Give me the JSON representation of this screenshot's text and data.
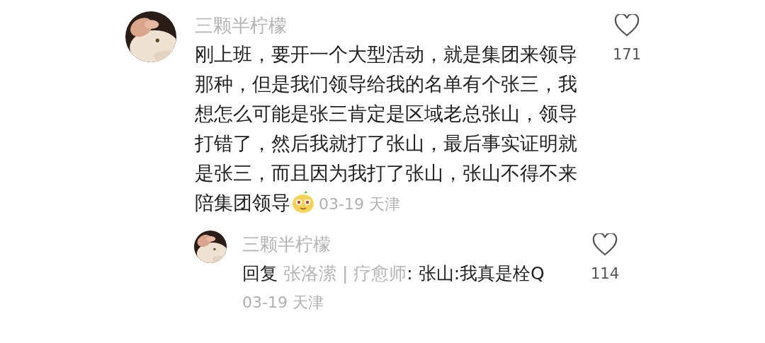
{
  "comment": {
    "author": "三颗半柠檬",
    "text": "刚上班，要开一个大型活动，就是集团来领导那种，但是我们领导给我的名单有个张三，我想怎么可能是张三肯定是区域老总张山，领导打错了，然后我就打了张山，最后事实证明就是张三，而且因为我打了张山，张山不得不来陪集团领导",
    "date": "03-19 天津",
    "likes": "171",
    "liked": false
  },
  "reply": {
    "author": "三颗半柠檬",
    "label": "回复",
    "reply_to": "张洛潆 | 疗愈师",
    "text": ": 张山:我真是栓Q",
    "date": "03-19 天津",
    "likes": "114",
    "liked": false
  }
}
